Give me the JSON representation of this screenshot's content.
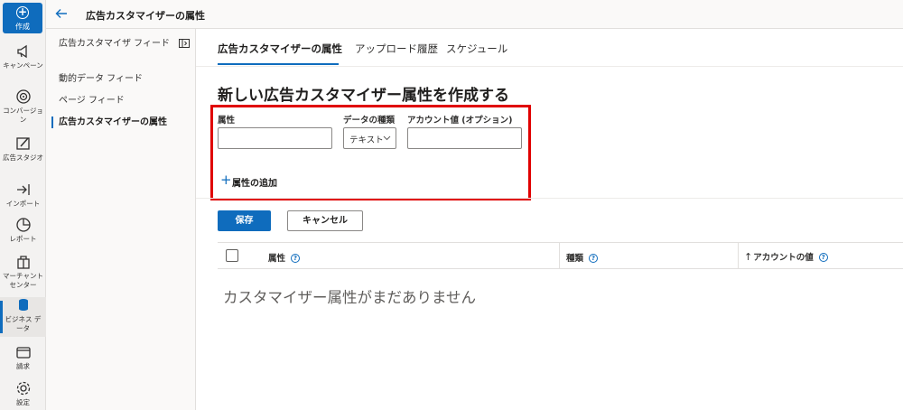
{
  "rail": {
    "create_label": "作成",
    "items": [
      {
        "label": "キャンペーン",
        "icon": "megaphone-icon"
      },
      {
        "label": "コンバージョン",
        "icon": "target-icon"
      },
      {
        "label": "広告スタジオ",
        "icon": "studio-icon"
      },
      {
        "label": "インポート",
        "icon": "import-icon"
      },
      {
        "label": "レポート",
        "icon": "report-icon"
      },
      {
        "label": "マーチャント センター",
        "icon": "merchant-icon"
      },
      {
        "label": "ビジネス データ",
        "icon": "database-icon"
      },
      {
        "label": "請求",
        "icon": "wallet-icon"
      },
      {
        "label": "設定",
        "icon": "gear-icon"
      }
    ]
  },
  "topbar": {
    "title": "広告カスタマイザーの属性"
  },
  "subnav": {
    "items": [
      {
        "label": "広告カスタマイザ フィード"
      },
      {
        "label": "動的データ フィード"
      },
      {
        "label": "ページ フィード"
      },
      {
        "label": "広告カスタマイザーの属性"
      }
    ]
  },
  "tabs": [
    {
      "label": "広告カスタマイザーの属性"
    },
    {
      "label": "アップロード履歴"
    },
    {
      "label": "スケジュール"
    }
  ],
  "form": {
    "heading": "新しい広告カスタマイザー属性を作成する",
    "attribute_label": "属性",
    "attribute_value": "",
    "data_type_label": "データの種類",
    "data_type_value": "テキスト",
    "account_value_label": "アカウント値 (オプション)",
    "account_value": "",
    "add_attribute_label": "属性の追加"
  },
  "buttons": {
    "save": "保存",
    "cancel": "キャンセル"
  },
  "table": {
    "columns": [
      {
        "label": "属性"
      },
      {
        "label": "種類"
      },
      {
        "label": "アカウントの値",
        "sort_glyph": "↑"
      }
    ],
    "empty_text": "カスタマイザー属性がまだありません"
  },
  "colors": {
    "accent": "#0f6cbd",
    "highlight_border": "#e00000"
  }
}
